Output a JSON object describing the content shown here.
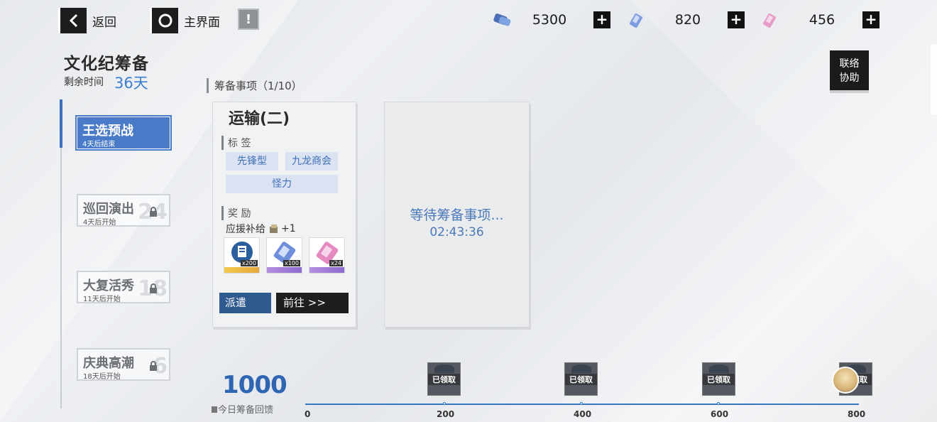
{
  "topbar": {
    "back_label": "返回",
    "home_label": "主界面",
    "resources": [
      {
        "icon": "ticket-blue-icon",
        "value": "5300"
      },
      {
        "icon": "crystal-blue-icon",
        "value": "820"
      },
      {
        "icon": "crystal-pink-icon",
        "value": "456"
      }
    ]
  },
  "event": {
    "title": "文化纪筹备",
    "remaining_label": "剩余时间",
    "remaining_value": "36天"
  },
  "help_button": "联络\n协助",
  "stages": [
    {
      "name": "王选预战",
      "status": "4天后结束",
      "locked": false,
      "number": ""
    },
    {
      "name": "巡回演出",
      "status": "4天后开始",
      "locked": true,
      "number": "24"
    },
    {
      "name": "大复活秀",
      "status": "11天后开始",
      "locked": true,
      "number": "18"
    },
    {
      "name": "庆典高潮",
      "status": "18天后开始",
      "locked": true,
      "number": "6"
    }
  ],
  "section_title": "筹备事项（1/10）",
  "task_card": {
    "title": "运输(二)",
    "tags_label": "标 签",
    "tags": [
      "先锋型",
      "九龙商会",
      "怪力"
    ],
    "rewards_label": "奖 励",
    "support_label": "应援补给",
    "support_count": "+1",
    "rewards": [
      {
        "icon": "supply-ticket-icon",
        "qty": "x200"
      },
      {
        "icon": "blue-crystal-icon",
        "qty": "x100"
      },
      {
        "icon": "pink-crystal-icon",
        "qty": "x24"
      }
    ],
    "dispatch_label": "派遣",
    "goto_label": "前往 >>"
  },
  "waiting_card": {
    "text": "等待筹备事项...",
    "timer": "02:43:36"
  },
  "progress": {
    "score": "1000",
    "score_label": "今日筹备回馈",
    "ticks": [
      "0",
      "200",
      "400",
      "600",
      "800"
    ],
    "milestone_label": "已领取",
    "milestones_claimed": 3,
    "fill_fraction": 1.0
  },
  "colors": {
    "accent_blue": "#3577c2",
    "active_stage": "#4a7bc8",
    "dark_button": "#1e1e20"
  }
}
